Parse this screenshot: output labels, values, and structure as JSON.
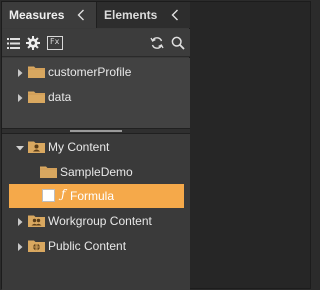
{
  "tabs": [
    {
      "label": "Measures",
      "icon": "chevron-left-icon",
      "active": true
    },
    {
      "label": "Elements",
      "icon": "chevron-left-icon",
      "active": false
    }
  ],
  "toolbar": {
    "left_icons": [
      "list-icon",
      "gear-icon",
      "fx-icon"
    ],
    "right_icons": [
      "refresh-icon",
      "search-icon"
    ],
    "fx_text": "Fx"
  },
  "tree_top": [
    {
      "label": "customerProfile",
      "icon": "folder-icon",
      "expanded": false
    },
    {
      "label": "data",
      "icon": "folder-icon",
      "expanded": false
    }
  ],
  "tree_bottom": {
    "my_content": {
      "label": "My Content",
      "icon": "user-folder-icon",
      "expanded": true
    },
    "sample_demo": {
      "label": "SampleDemo",
      "icon": "folder-icon"
    },
    "formula": {
      "label": "Formula",
      "icon": "formula-icon",
      "selected": true
    },
    "workgroup": {
      "label": "Workgroup Content",
      "icon": "group-folder-icon",
      "expanded": false
    },
    "public": {
      "label": "Public Content",
      "icon": "globe-folder-icon",
      "expanded": false
    }
  },
  "colors": {
    "selection": "#f5a94a",
    "folder": "#d9a860",
    "panel": "#3a3a3a",
    "background": "#262626"
  }
}
